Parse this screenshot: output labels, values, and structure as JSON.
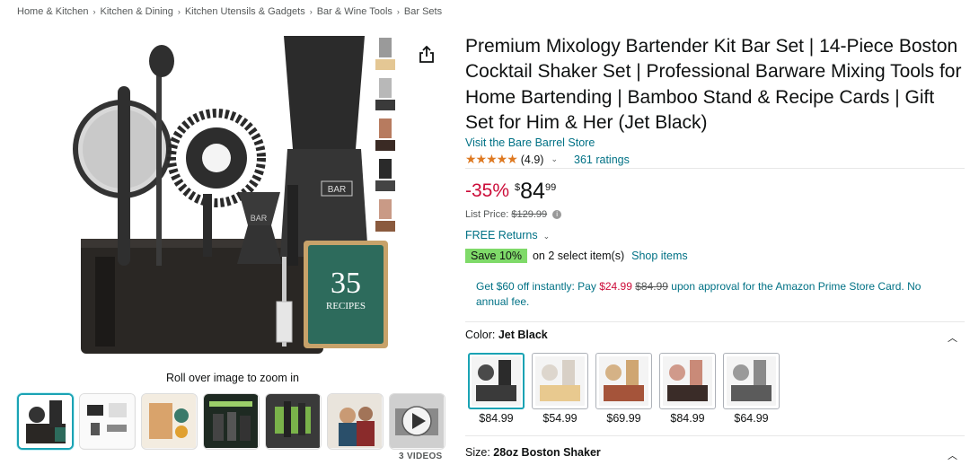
{
  "breadcrumb": [
    "Home & Kitchen",
    "Kitchen & Dining",
    "Kitchen Utensils & Gadgets",
    "Bar & Wine Tools",
    "Bar Sets"
  ],
  "gallery": {
    "zoom_hint": "Roll over image to zoom in",
    "videos_label": "3 VIDEOS",
    "main_image_badge_number": "35",
    "main_image_badge_text": "RECIPES",
    "brand_text": "BAR"
  },
  "product": {
    "title": "Premium Mixology Bartender Kit Bar Set | 14-Piece Boston Cocktail Shaker Set | Professional Barware Mixing Tools for Home Bartending | Bamboo Stand & Recipe Cards | Gift Set for Him & Her (Jet Black)",
    "store_link": "Visit the Bare Barrel Store",
    "rating_stars": "★★★★★",
    "rating_value": "(4.9)",
    "ratings_count": "361 ratings"
  },
  "price": {
    "discount": "-35%",
    "currency": "$",
    "whole": "84",
    "fraction": "99",
    "list_price_label": "List Price:",
    "list_price": "$129.99",
    "free_returns": "FREE Returns"
  },
  "promo": {
    "badge": "Save 10%",
    "text": "on 2 select item(s)",
    "link": "Shop items"
  },
  "card_offer": {
    "part1": "Get $60 off instantly: Pay",
    "pay_price": "$24.99",
    "orig_price": "$84.99",
    "part2": "upon approval for the Amazon Prime Store Card. No annual fee."
  },
  "color": {
    "label": "Color:",
    "selected": "Jet Black",
    "options": [
      {
        "price": "$84.99",
        "tone": "#2b2b2b",
        "base": "#3a3a3a"
      },
      {
        "price": "$54.99",
        "tone": "#d8d0c6",
        "base": "#e8c98f"
      },
      {
        "price": "$69.99",
        "tone": "#cfa672",
        "base": "#a5543a"
      },
      {
        "price": "$84.99",
        "tone": "#c98a78",
        "base": "#3a2c28"
      },
      {
        "price": "$64.99",
        "tone": "#8a8a8a",
        "base": "#5b5b5b"
      }
    ]
  },
  "size": {
    "label": "Size:",
    "selected": "28oz Boston Shaker"
  },
  "colors": {
    "link": "#007185",
    "price_red": "#cc0c39",
    "star": "#de7921",
    "save_badge": "#7fda69",
    "selected_border": "#1aa3b4"
  }
}
